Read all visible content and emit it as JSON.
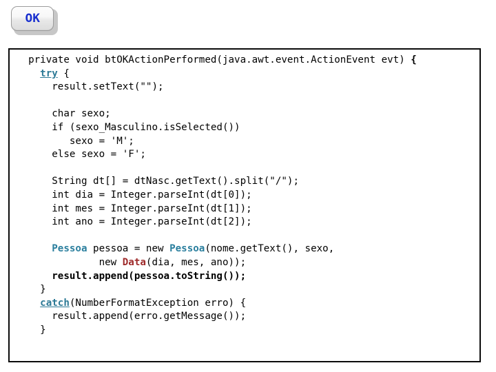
{
  "button": {
    "label": "OK",
    "color": "#1a30cf"
  },
  "code_box": {
    "border_color": "#0a0a0a",
    "background": "#ffffff",
    "colors": {
      "keyword": "#2d7a96",
      "type_blue": "#2b7f9e",
      "type_red": "#9e2a2a",
      "plain": "#000000"
    },
    "lines": [
      {
        "segments": [
          {
            "text": "  private void btOKActionPerformed(java.awt.event.ActionEvent evt) ",
            "style": "plain"
          },
          {
            "text": "{",
            "style": "bold"
          }
        ]
      },
      {
        "segments": [
          {
            "text": "    ",
            "style": "plain"
          },
          {
            "text": "try",
            "style": "keyword"
          },
          {
            "text": " {",
            "style": "plain"
          }
        ]
      },
      {
        "segments": [
          {
            "text": "      result.setText(\"\");",
            "style": "plain"
          }
        ]
      },
      {
        "segments": [
          {
            "text": "",
            "style": "plain"
          }
        ]
      },
      {
        "segments": [
          {
            "text": "      char sexo;",
            "style": "plain"
          }
        ]
      },
      {
        "segments": [
          {
            "text": "      if (sexo_Masculino.isSelected())",
            "style": "plain"
          }
        ]
      },
      {
        "segments": [
          {
            "text": "         sexo = 'M';",
            "style": "plain"
          }
        ]
      },
      {
        "segments": [
          {
            "text": "      else sexo = 'F';",
            "style": "plain"
          }
        ]
      },
      {
        "segments": [
          {
            "text": "",
            "style": "plain"
          }
        ]
      },
      {
        "segments": [
          {
            "text": "      String dt[] = dtNasc.getText().split(\"/\");",
            "style": "plain"
          }
        ]
      },
      {
        "segments": [
          {
            "text": "      int dia = Integer.parseInt(dt[0]);",
            "style": "plain"
          }
        ]
      },
      {
        "segments": [
          {
            "text": "      int mes = Integer.parseInt(dt[1]);",
            "style": "plain"
          }
        ]
      },
      {
        "segments": [
          {
            "text": "      int ano = Integer.parseInt(dt[2]);",
            "style": "plain"
          }
        ]
      },
      {
        "segments": [
          {
            "text": "",
            "style": "plain"
          }
        ]
      },
      {
        "segments": [
          {
            "text": "      ",
            "style": "plain"
          },
          {
            "text": "Pessoa",
            "style": "type_blue"
          },
          {
            "text": " pessoa = new ",
            "style": "plain"
          },
          {
            "text": "Pessoa",
            "style": "type_blue"
          },
          {
            "text": "(nome.getText(), sexo,",
            "style": "plain"
          }
        ]
      },
      {
        "segments": [
          {
            "text": "              new ",
            "style": "plain"
          },
          {
            "text": "Data",
            "style": "type_red"
          },
          {
            "text": "(dia, mes, ano));",
            "style": "plain"
          }
        ]
      },
      {
        "segments": [
          {
            "text": "      ",
            "style": "plain"
          },
          {
            "text": "result.append(pessoa.toString());",
            "style": "bold"
          }
        ]
      },
      {
        "segments": [
          {
            "text": "    }",
            "style": "plain"
          }
        ]
      },
      {
        "segments": [
          {
            "text": "    ",
            "style": "plain"
          },
          {
            "text": "catch",
            "style": "keyword"
          },
          {
            "text": "(NumberFormatException erro) {",
            "style": "plain"
          }
        ]
      },
      {
        "segments": [
          {
            "text": "      result.append(erro.getMessage());",
            "style": "plain"
          }
        ]
      },
      {
        "segments": [
          {
            "text": "    }",
            "style": "plain"
          }
        ]
      },
      {
        "segments": [
          {
            "text": "",
            "style": "plain"
          }
        ]
      },
      {
        "segments": [
          {
            "text": "",
            "style": "plain"
          }
        ]
      },
      {
        "segments": [
          {
            "text": "  ",
            "style": "plain"
          },
          {
            "text": "}",
            "style": "bold"
          }
        ]
      }
    ]
  }
}
